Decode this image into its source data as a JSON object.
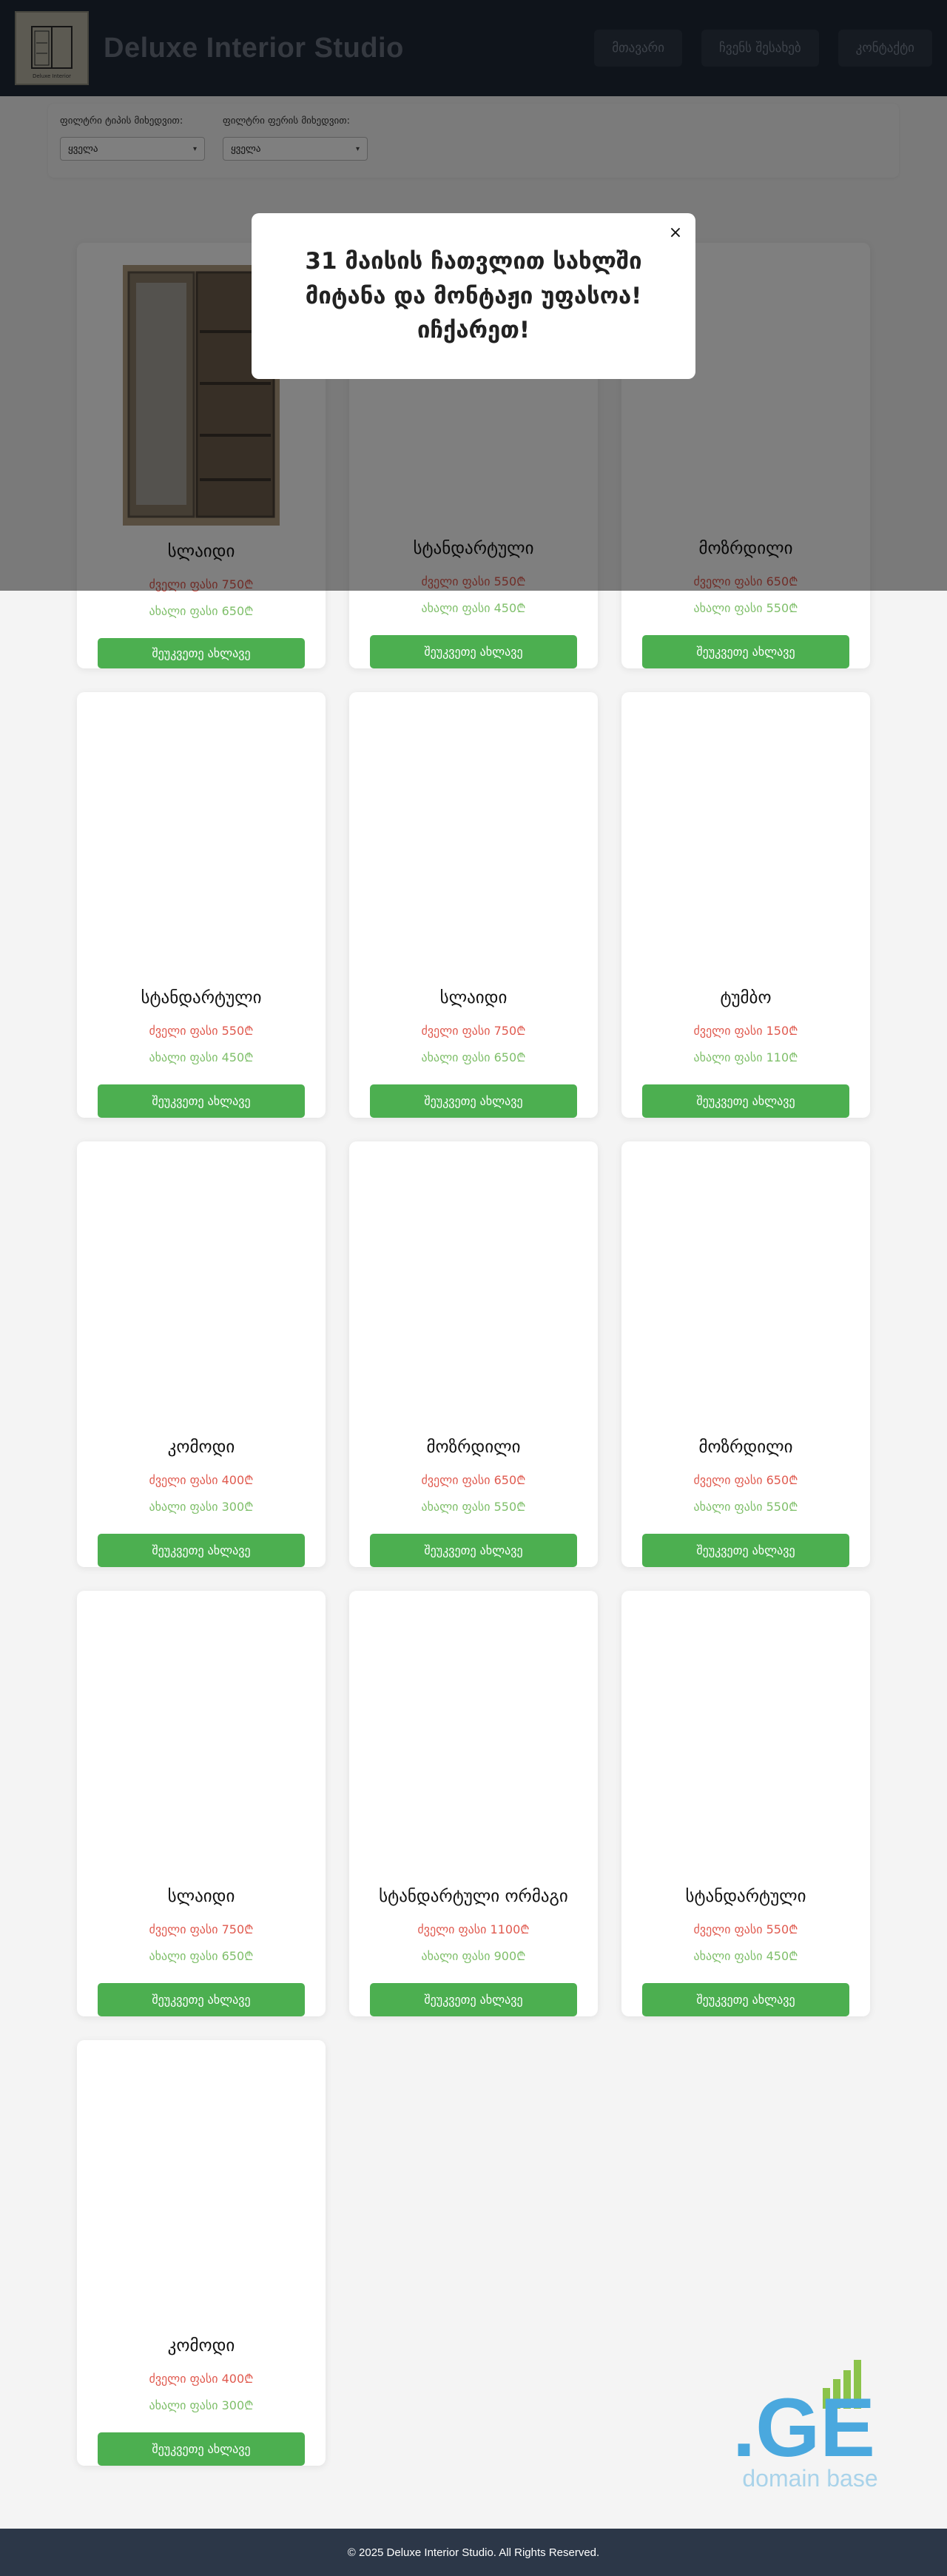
{
  "header": {
    "logo_caption": "Deluxe Interior",
    "brand": "Deluxe Interior Studio",
    "nav": [
      "მთავარი",
      "ჩვენს შესახებ",
      "კონტაქტი"
    ]
  },
  "filters": [
    {
      "label": "ფილტრი ტიპის მიხედვით:",
      "value": "ყველა"
    },
    {
      "label": "ფილტრი ფერის მიხედვით:",
      "value": "ყველა"
    }
  ],
  "buy_label": "შეუკვეთე ახლავე",
  "products": [
    {
      "title": "სლაიდი",
      "old_price": "ძველი ფასი 750₾",
      "new_price": "ახალი ფასი 650₾",
      "has_image": true
    },
    {
      "title": "სტანდარტული",
      "old_price": "ძველი ფასი 550₾",
      "new_price": "ახალი ფასი 450₾",
      "has_image": false
    },
    {
      "title": "მოზრდილი",
      "old_price": "ძველი ფასი 650₾",
      "new_price": "ახალი ფასი 550₾",
      "has_image": false
    },
    {
      "title": "სტანდარტული",
      "old_price": "ძველი ფასი 550₾",
      "new_price": "ახალი ფასი 450₾",
      "has_image": false
    },
    {
      "title": "სლაიდი",
      "old_price": "ძველი ფასი 750₾",
      "new_price": "ახალი ფასი 650₾",
      "has_image": false
    },
    {
      "title": "ტუმბო",
      "old_price": "ძველი ფასი 150₾",
      "new_price": "ახალი ფასი 110₾",
      "has_image": false
    },
    {
      "title": "კომოდი",
      "old_price": "ძველი ფასი 400₾",
      "new_price": "ახალი ფასი 300₾",
      "has_image": false
    },
    {
      "title": "მოზრდილი",
      "old_price": "ძველი ფასი 650₾",
      "new_price": "ახალი ფასი 550₾",
      "has_image": false
    },
    {
      "title": "მოზრდილი",
      "old_price": "ძველი ფასი 650₾",
      "new_price": "ახალი ფასი 550₾",
      "has_image": false
    },
    {
      "title": "სლაიდი",
      "old_price": "ძველი ფასი 750₾",
      "new_price": "ახალი ფასი 650₾",
      "has_image": false
    },
    {
      "title": "სტანდარტული ორმაგი",
      "old_price": "ძველი ფასი 1100₾",
      "new_price": "ახალი ფასი 900₾",
      "has_image": false
    },
    {
      "title": "სტანდარტული",
      "old_price": "ძველი ფასი 550₾",
      "new_price": "ახალი ფასი 450₾",
      "has_image": false
    },
    {
      "title": "კომოდი",
      "old_price": "ძველი ფასი 400₾",
      "new_price": "ახალი ფასი 300₾",
      "has_image": false
    }
  ],
  "modal": {
    "text": "31 მაისის ჩათვლით სახლში მიტანა და მონტაჟი უფასოა! იჩქარეთ!",
    "close": "×"
  },
  "domain_badge": {
    "mark": ".GE",
    "sub": "domain base"
  },
  "footer": {
    "text": "© 2025 Deluxe Interior Studio. All Rights Reserved."
  },
  "colors": {
    "header_bg": "#1f2836",
    "footer_bg": "#2c3748",
    "button_green": "#4caf50",
    "old_price_red": "#e05a4f",
    "new_price_green": "#7fbf6a",
    "domain_blue": "#4aa8de"
  }
}
